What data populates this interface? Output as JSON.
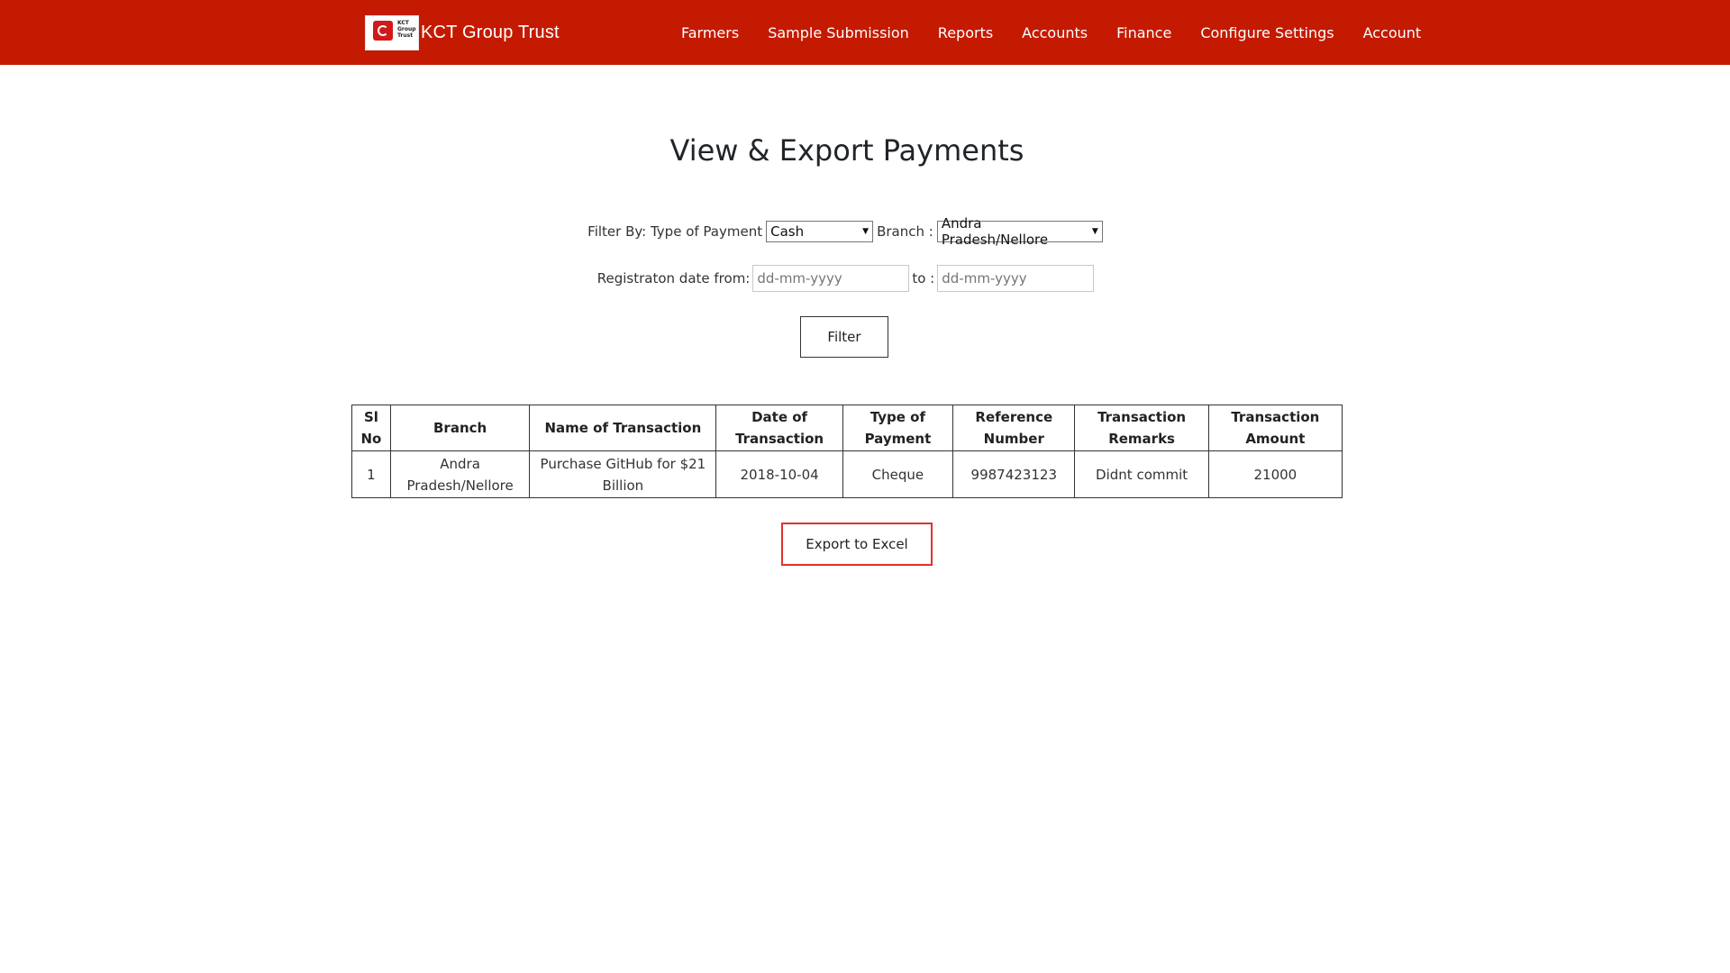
{
  "header": {
    "brand_title": "KCT Group Trust",
    "logo_text_lines": [
      "KCT",
      "Group",
      "Trust"
    ],
    "nav_items": [
      "Farmers",
      "Sample Submission",
      "Reports",
      "Accounts",
      "Finance",
      "Configure Settings",
      "Account"
    ]
  },
  "main": {
    "title": "View & Export Payments",
    "filter": {
      "type_label": "Filter By: Type of Payment",
      "type_value": "Cash",
      "branch_label": "Branch :",
      "branch_value": "Andra Pradesh/Nellore",
      "date_label": "Registraton date from:",
      "date_from_placeholder": "dd-mm-yyyy",
      "to_label": "to :",
      "date_to_placeholder": "dd-mm-yyyy",
      "button_label": "Filter"
    },
    "table": {
      "headers": [
        "Sl No",
        "Branch",
        "Name of Transaction",
        "Date of Transaction",
        "Type of Payment",
        "Reference Number",
        "Transaction Remarks",
        "Transaction Amount"
      ],
      "rows": [
        [
          "1",
          "Andra Pradesh/Nellore",
          "Purchase GitHub for $21 Billion",
          "2018-10-04",
          "Cheque",
          "9987423123",
          "Didnt commit",
          "21000"
        ]
      ]
    },
    "export_label": "Export to Excel"
  },
  "colors": {
    "navbar": "#c41a02",
    "export_border": "#e0322a"
  }
}
